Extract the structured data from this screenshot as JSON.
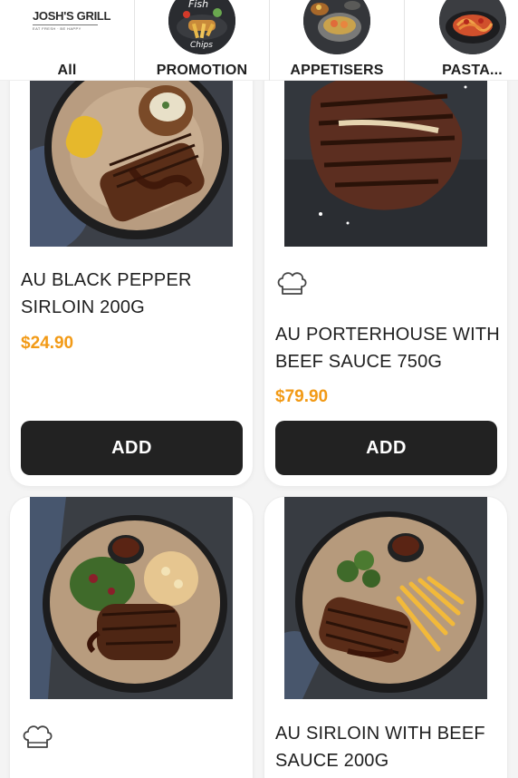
{
  "brand": {
    "name": "JOSH'S GRILL",
    "tagline": "EAT FRESH · BE HAPPY"
  },
  "categories": [
    {
      "label": "All",
      "thumb": "josh-grill-logo",
      "selected": true
    },
    {
      "label": "PROMOTION",
      "thumb": "fish-and-chips-promo-image"
    },
    {
      "label": "APPETISERS",
      "thumb": "appetiser-bowls-image"
    },
    {
      "label": "PASTA...",
      "thumb": "pasta-dish-image"
    }
  ],
  "products": [
    {
      "name_line1": "AU BLACK PEPPER",
      "name_line2": "SIRLOIN 200G",
      "price": "$24.90",
      "add_label": "ADD",
      "image": "sirloin-with-corn-and-potato",
      "chef_icon": false
    },
    {
      "name_line1": "AU PORTERHOUSE WITH",
      "name_line2": "BEEF SAUCE 750G",
      "price": "$79.90",
      "add_label": "ADD",
      "image": "porterhouse-on-slate",
      "chef_icon": true
    },
    {
      "name_line1": "",
      "name_line2": "",
      "price": "",
      "add_label": "",
      "image": "steak-with-salad-and-pasta",
      "chef_icon": true
    },
    {
      "name_line1": "AU SIRLOIN WITH BEEF",
      "name_line2": "SAUCE 200G",
      "price": "",
      "add_label": "",
      "image": "sirloin-with-broccoli-and-fries",
      "chef_icon": false
    }
  ],
  "colors": {
    "price": "#f29a16",
    "button_bg": "#222222",
    "button_text": "#ffffff",
    "card_bg": "#ffffff",
    "page_bg": "#f4f4f4"
  }
}
